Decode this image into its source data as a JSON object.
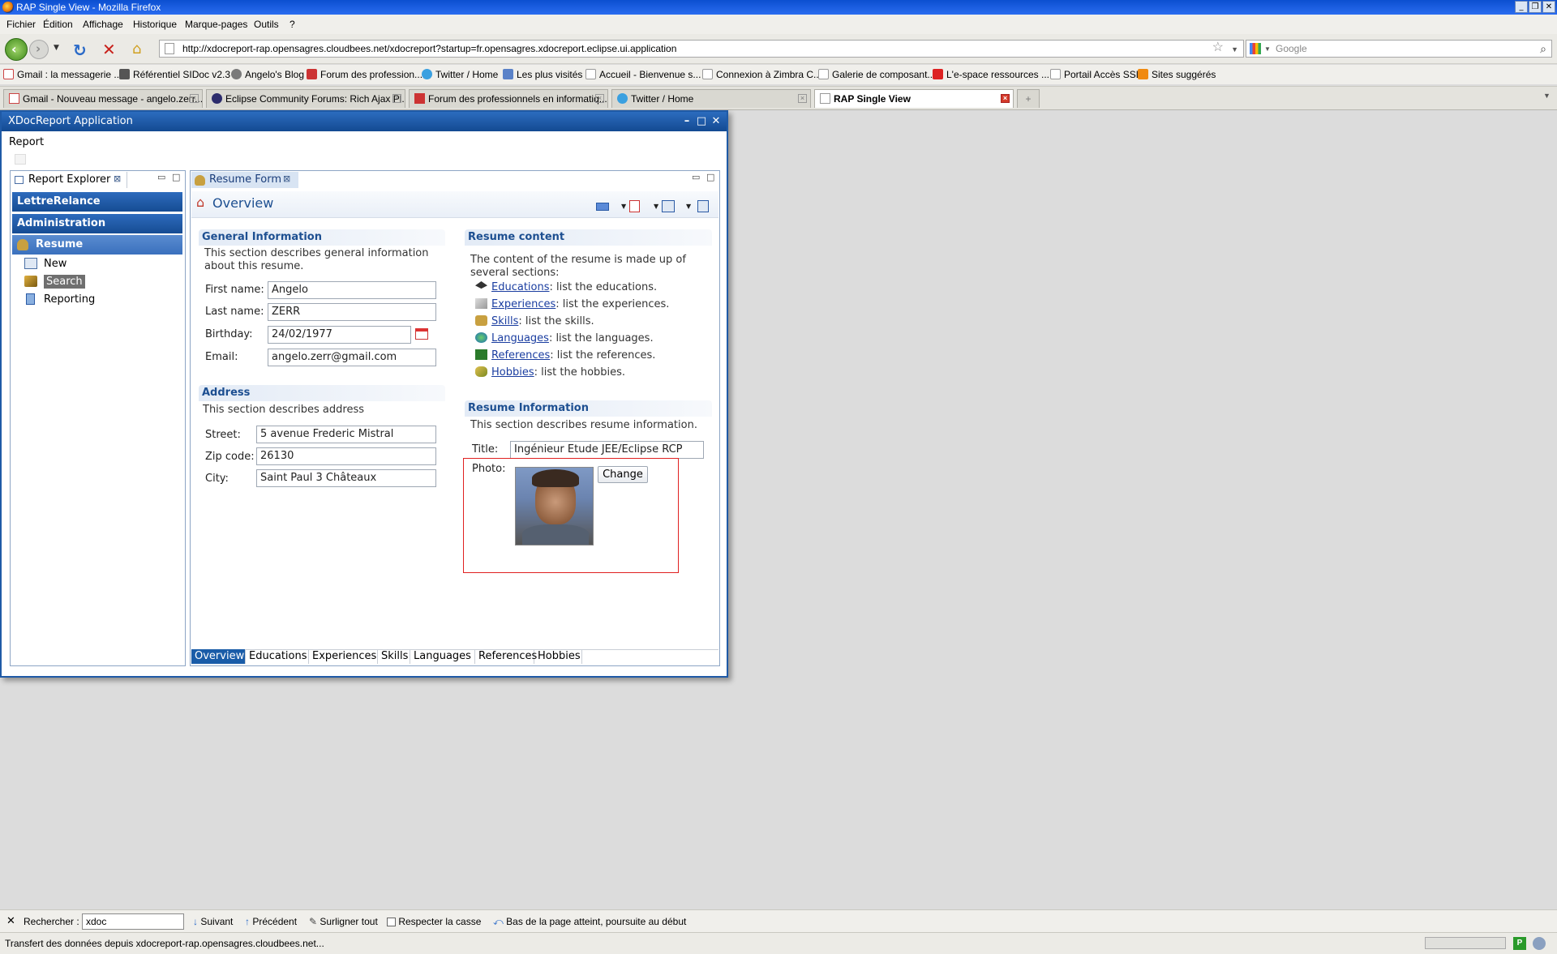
{
  "window": {
    "title": "RAP Single View - Mozilla Firefox"
  },
  "menu": [
    "Fichier",
    "Édition",
    "Affichage",
    "Historique",
    "Marque-pages",
    "Outils",
    "?"
  ],
  "url": "http://xdocreport-rap.opensagres.cloudbees.net/xdocreport?startup=fr.opensagres.xdocreport.eclipse.ui.application",
  "search": {
    "placeholder": "Google"
  },
  "bookmarks": [
    "Gmail : la messagerie ...",
    "Référentiel SIDoc v2.3",
    "Angelo's Blog",
    "Forum des profession...",
    "Twitter / Home",
    "Les plus visités",
    "Accueil - Bienvenue s...",
    "Connexion à Zimbra C...",
    "Galerie de composant...",
    "L'e-space ressources ...",
    "Portail Accès SSL",
    "Sites suggérés"
  ],
  "tabs": [
    "Gmail - Nouveau message - angelo.zerr...",
    "Eclipse Community Forums: Rich Ajax Pl...",
    "Forum des professionnels en informatiq...",
    "Twitter / Home",
    "RAP Single View"
  ],
  "app": {
    "title": "XDocReport Application",
    "menu_report": "Report",
    "explorer": {
      "title": "Report Explorer",
      "groups": [
        "LettreRelance",
        "Administration",
        "Resume"
      ],
      "items": [
        "New",
        "Search",
        "Reporting"
      ]
    },
    "editor": {
      "tab": "Resume Form",
      "heading": "Overview",
      "general": {
        "title": "General Information",
        "desc": "This section describes general information about this resume.",
        "first_name_label": "First name:",
        "first_name": "Angelo",
        "last_name_label": "Last name:",
        "last_name": "ZERR",
        "birthday_label": "Birthday:",
        "birthday": "24/02/1977",
        "email_label": "Email:",
        "email": "angelo.zerr@gmail.com"
      },
      "address": {
        "title": "Address",
        "desc": "This section describes address",
        "street_label": "Street:",
        "street": "5 avenue Frederic Mistral",
        "zip_label": "Zip code:",
        "zip": "26130",
        "city_label": "City:",
        "city": "Saint Paul 3 Châteaux"
      },
      "content": {
        "title": "Resume content",
        "desc": "The content of the resume is made up of several sections:",
        "links": [
          {
            "name": "Educations",
            "desc": ": list the educations."
          },
          {
            "name": "Experiences",
            "desc": ": list the experiences."
          },
          {
            "name": "Skills",
            "desc": ": list the skills."
          },
          {
            "name": "Languages",
            "desc": ": list the languages."
          },
          {
            "name": "References",
            "desc": ": list the references."
          },
          {
            "name": "Hobbies",
            "desc": ": list the hobbies."
          }
        ]
      },
      "info": {
        "title": "Resume Information",
        "desc": "This section describes resume information.",
        "title_label": "Title:",
        "title_value": "Ingénieur Etude JEE/Eclipse RCP",
        "photo_label": "Photo:",
        "change_button": "Change"
      },
      "bottom_tabs": [
        "Overview",
        "Educations",
        "Experiences",
        "Skills",
        "Languages",
        "References",
        "Hobbies"
      ]
    }
  },
  "findbar": {
    "label": "Rechercher :",
    "value": "xdoc",
    "next": "Suivant",
    "prev": "Précédent",
    "highlight": "Surligner tout",
    "match_case": "Respecter la casse",
    "status": "Bas de la page atteint, poursuite au début"
  },
  "status": "Transfert des données depuis xdocreport-rap.opensagres.cloudbees.net..."
}
